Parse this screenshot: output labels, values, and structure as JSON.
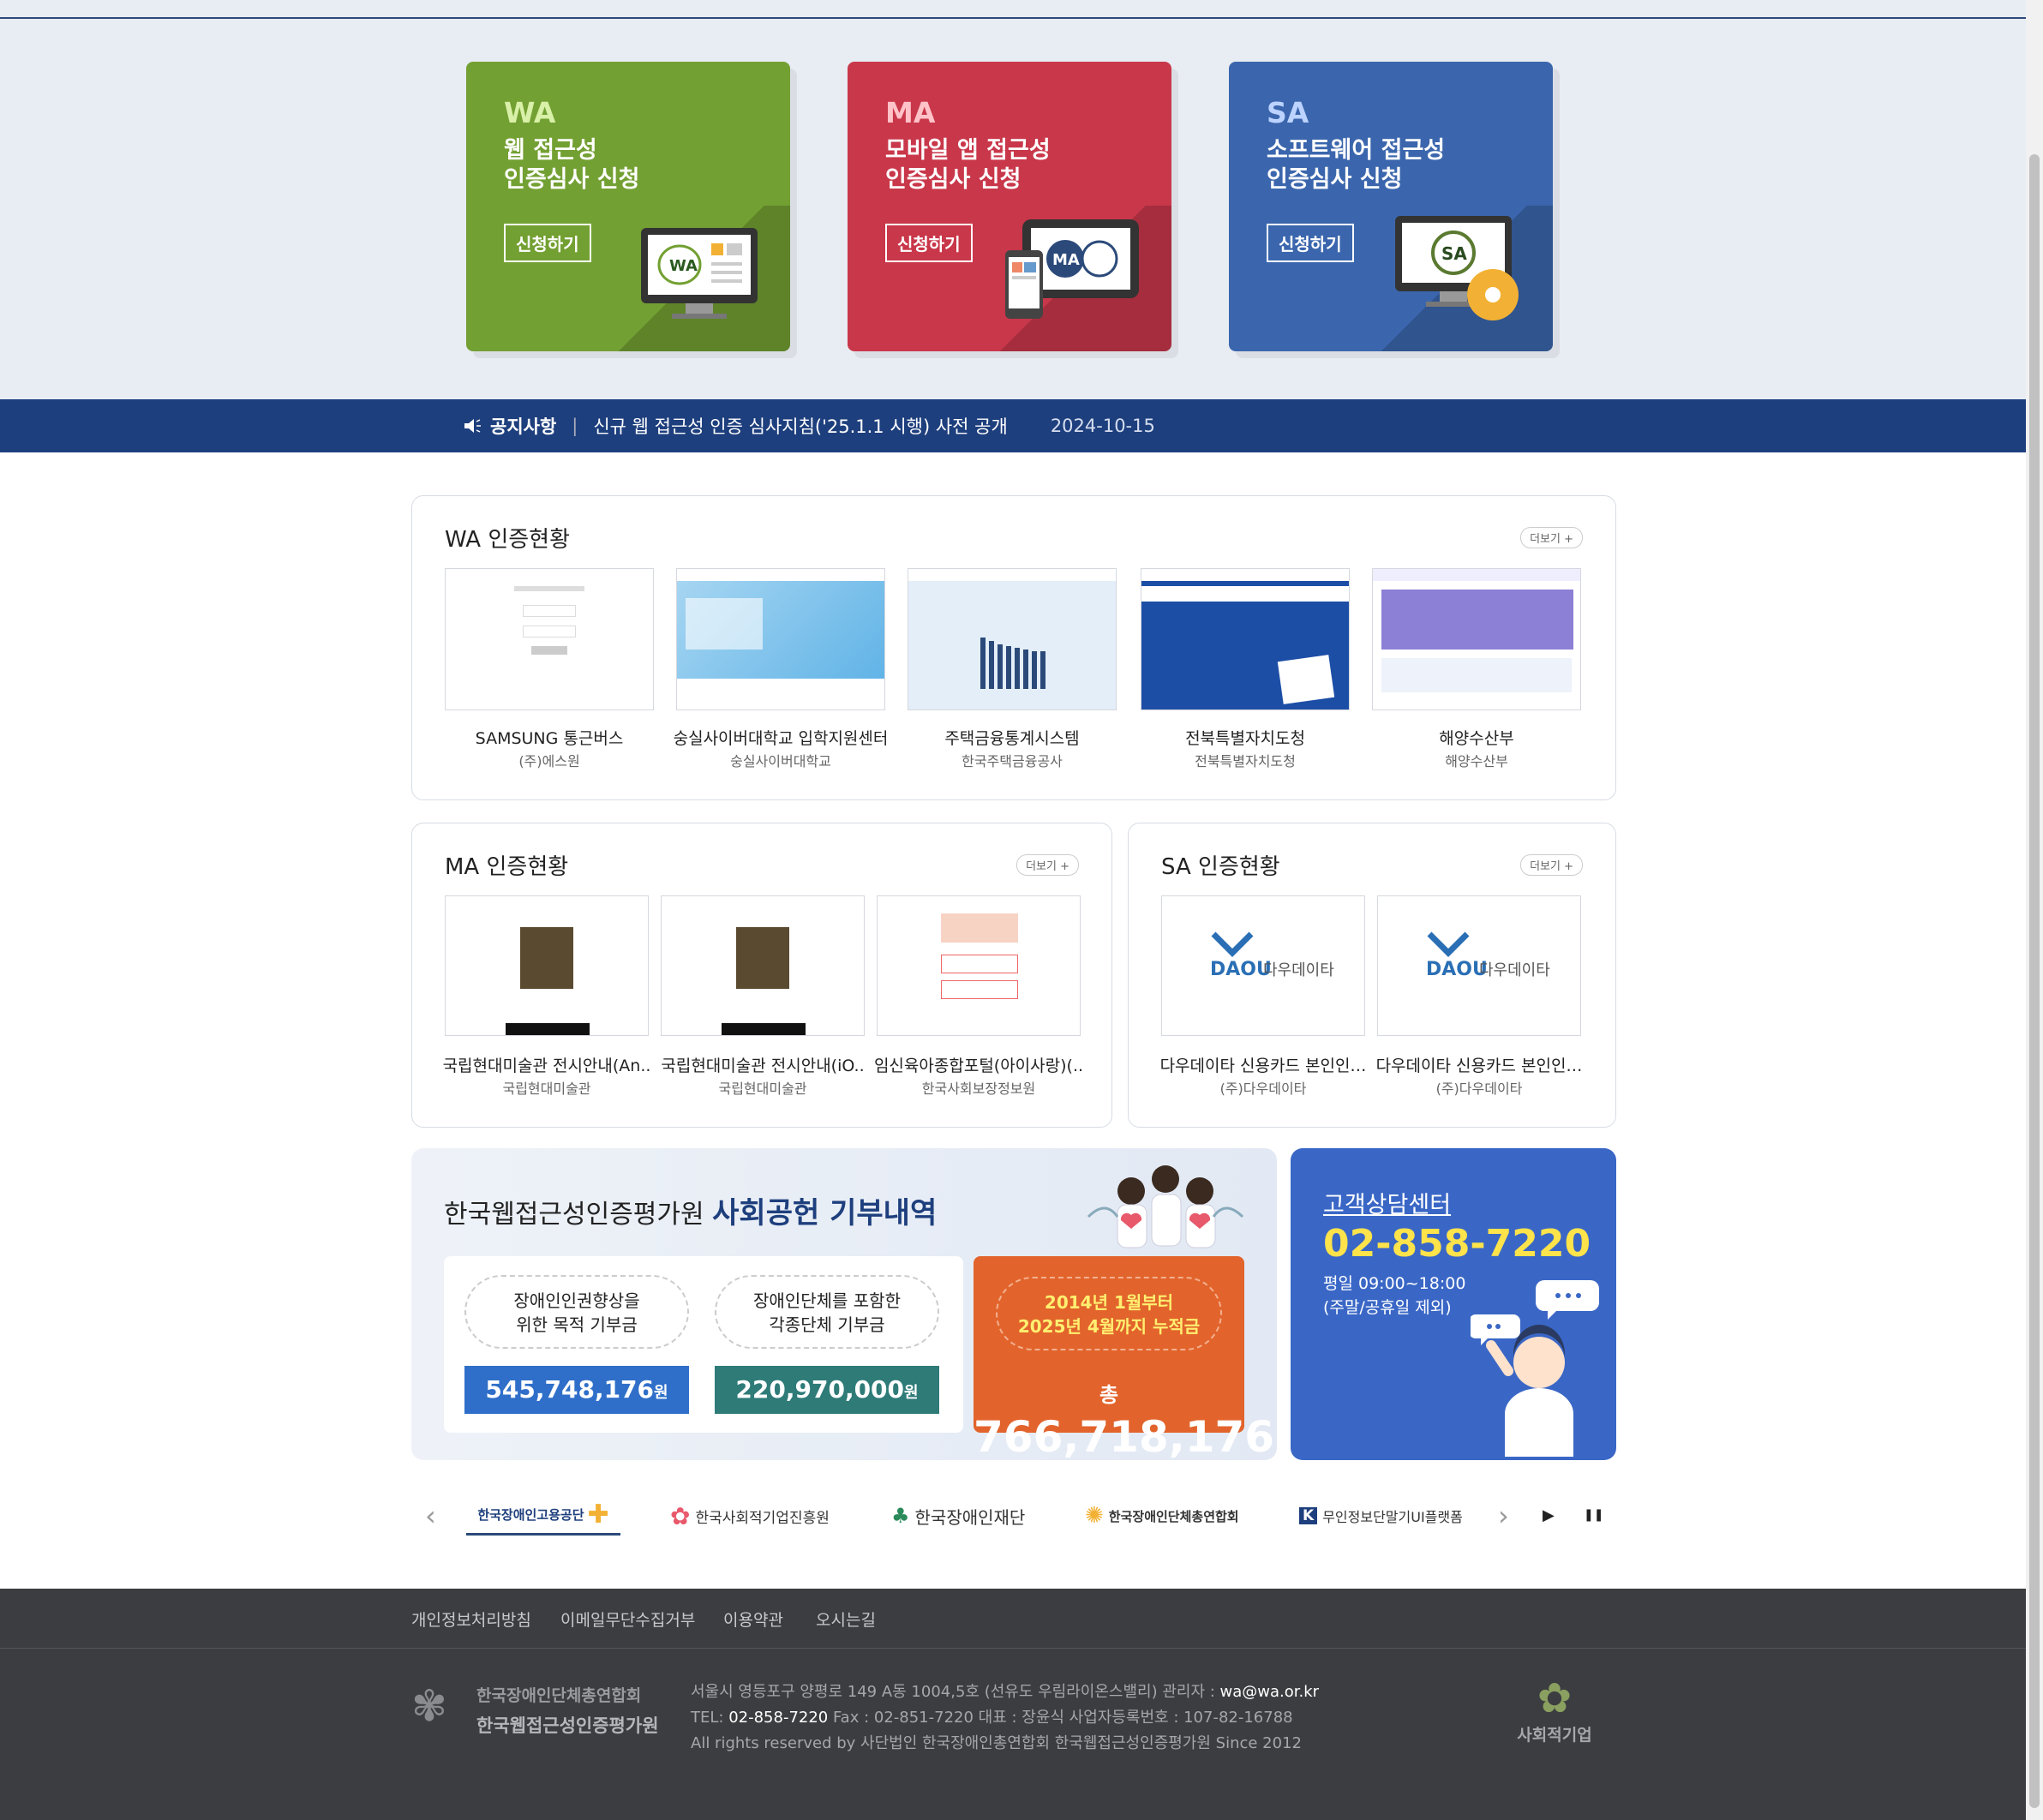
{
  "hero_cards": [
    {
      "code": "WA",
      "line1": "웹 접근성",
      "line2": "인증심사 신청",
      "button": "신청하기",
      "color": "#73a032"
    },
    {
      "code": "MA",
      "line1": "모바일 앱 접근성",
      "line2": "인증심사 신청",
      "button": "신청하기",
      "color": "#c9374a"
    },
    {
      "code": "SA",
      "line1": "소프트웨어 접근성",
      "line2": "인증심사 신청",
      "button": "신청하기",
      "color": "#3b66ad"
    }
  ],
  "notice": {
    "label": "공지사항",
    "separator": "|",
    "text": "신규 웹 접근성 인증 심사지침('25.1.1 시행) 사전 공개",
    "date": "2024-10-15"
  },
  "wa": {
    "title": "WA 인증현황",
    "more": "더보기 +",
    "items": [
      {
        "title": "SAMSUNG 통근버스",
        "org": "(주)에스원"
      },
      {
        "title": "숭실사이버대학교 입학지원센터",
        "org": "숭실사이버대학교"
      },
      {
        "title": "주택금융통계시스템",
        "org": "한국주택금융공사"
      },
      {
        "title": "전북특별자치도청",
        "org": "전북특별자치도청"
      },
      {
        "title": "해양수산부",
        "org": "해양수산부"
      }
    ]
  },
  "ma": {
    "title": "MA 인증현황",
    "more": "더보기 +",
    "items": [
      {
        "title": "국립현대미술관 전시안내(An..",
        "org": "국립현대미술관"
      },
      {
        "title": "국립현대미술관 전시안내(iO..",
        "org": "국립현대미술관"
      },
      {
        "title": "임신육아종합포털(아이사랑)(..",
        "org": "한국사회보장정보원"
      }
    ]
  },
  "sa": {
    "title": "SA 인증현황",
    "more": "더보기 +",
    "items": [
      {
        "title": "다우데이타 신용카드 본인인…",
        "org": "(주)다우데이타",
        "logo_en": "DAOU",
        "logo_ko": "다우데이타"
      },
      {
        "title": "다우데이타 신용카드 본인인…",
        "org": "(주)다우데이타",
        "logo_en": "DAOU",
        "logo_ko": "다우데이타"
      }
    ]
  },
  "donation": {
    "title_prefix": "한국웹접근성인증평가원",
    "title_bold": "사회공헌 기부내역",
    "purpose1_l1": "장애인인권향상을",
    "purpose1_l2": "위한 목적 기부금",
    "amount1": "545,748,176",
    "unit": "원",
    "purpose2_l1": "장애인단체를 포함한",
    "purpose2_l2": "각종단체 기부금",
    "amount2": "220,970,000",
    "period_l1": "2014년 1월부터",
    "period_l2": "2025년 4월까지 누적금",
    "total_prefix": "총",
    "total": "766,718,176"
  },
  "cs": {
    "title": "고객상담센터",
    "phone": "02-858-7220",
    "hours_l1": "평일 09:00~18:00",
    "hours_l2": "(주말/공휴일 제외)"
  },
  "partners": {
    "prev": "‹",
    "next": "›",
    "play": "▶",
    "pause": "❚❚",
    "items": [
      "한국장애인고용공단",
      "한국사회적기업진흥원",
      "한국장애인재단",
      "한국장애인단체총연합회",
      "무인정보단말기UI플랫폼"
    ]
  },
  "footer": {
    "links": [
      "개인정보처리방침",
      "이메일무단수집거부",
      "이용약관",
      "오시는길"
    ],
    "org1": "한국장애인단체총연합회",
    "org2": "한국웹접근성인증평가원",
    "addr_pre": "서울시 영등포구 양평로 149 A동 1004,5호 (선유도 우림라이온스밸리) 관리자 : ",
    "email": "wa@wa.or.kr",
    "tel_pre": "TEL: ",
    "tel": "02-858-7220",
    "tel_post": " Fax : 02-851-7220 대표 : 장윤식 사업자등록번호 : 107-82-16788",
    "copyright": "All rights reserved by 사단법인 한국장애인총연합회 한국웹접근성인증평가원 Since 2012",
    "social": "사회적기업"
  }
}
